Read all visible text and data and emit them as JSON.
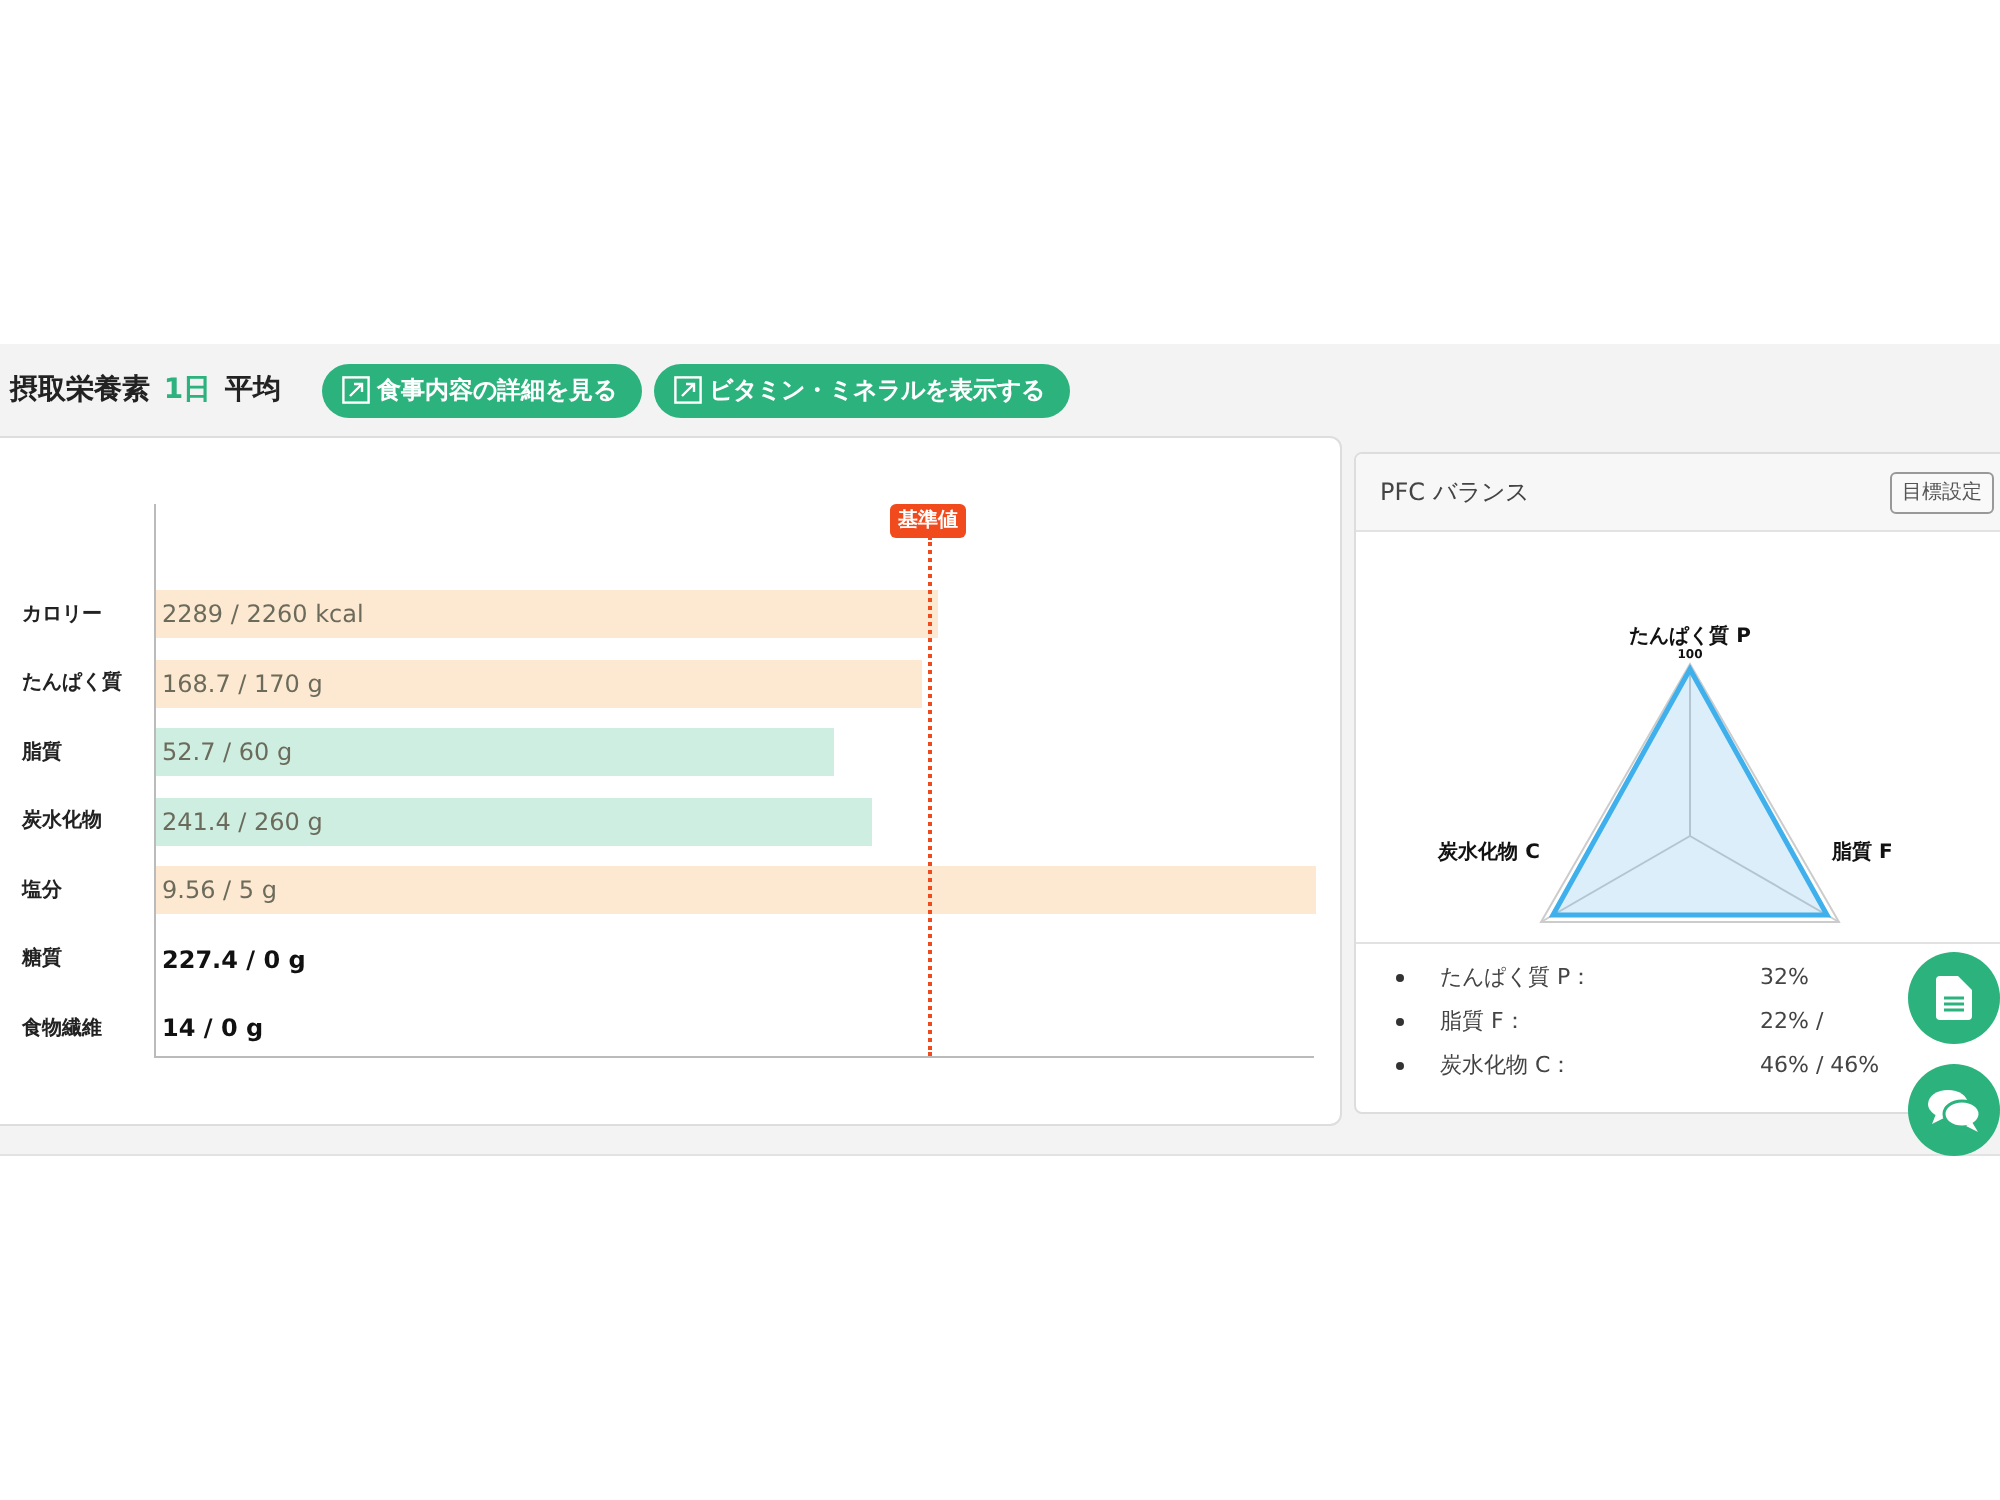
{
  "header": {
    "title_prefix": "摂取栄養素",
    "period": "1日",
    "title_suffix": "平均",
    "buttons": [
      {
        "label": "食事内容の詳細を見る"
      },
      {
        "label": "ビタミン・ミネラルを表示する"
      }
    ]
  },
  "nutrients": {
    "reference": {
      "label": "基準値",
      "level": 0.665
    },
    "rows": [
      {
        "name": "カロリー",
        "reading": "2289 / 2260 kcal",
        "level": 0.674,
        "color": "#fde8d1"
      },
      {
        "name": "たんぱく質",
        "reading": "168.7 / 170 g",
        "level": 0.66,
        "color": "#fde8d1"
      },
      {
        "name": "脂質",
        "reading": "52.7 / 60 g",
        "level": 0.584,
        "color": "#cfeee2"
      },
      {
        "name": "炭水化物",
        "reading": "241.4 / 260 g",
        "level": 0.617,
        "color": "#cfeee2"
      },
      {
        "name": "塩分",
        "reading": "9.56 / 5 g",
        "level": 1,
        "color": "#fde8d1"
      },
      {
        "name": "糖質",
        "reading": "227.4 / 0 g"
      },
      {
        "name": "食物繊維",
        "reading": "14 / 0 g"
      }
    ]
  },
  "pfc": {
    "title": "PFC バランス",
    "button": "目標設定",
    "radar": {
      "tick": "100",
      "axes": [
        "たんぱく質 P",
        "脂質 F",
        "炭水化物 C"
      ]
    },
    "items": [
      {
        "label": "たんぱく質 P：",
        "value": "32%"
      },
      {
        "label": "脂質 F：",
        "value": "22% /"
      },
      {
        "label": "炭水化物 C：",
        "value": "46% / 46%"
      }
    ]
  }
}
